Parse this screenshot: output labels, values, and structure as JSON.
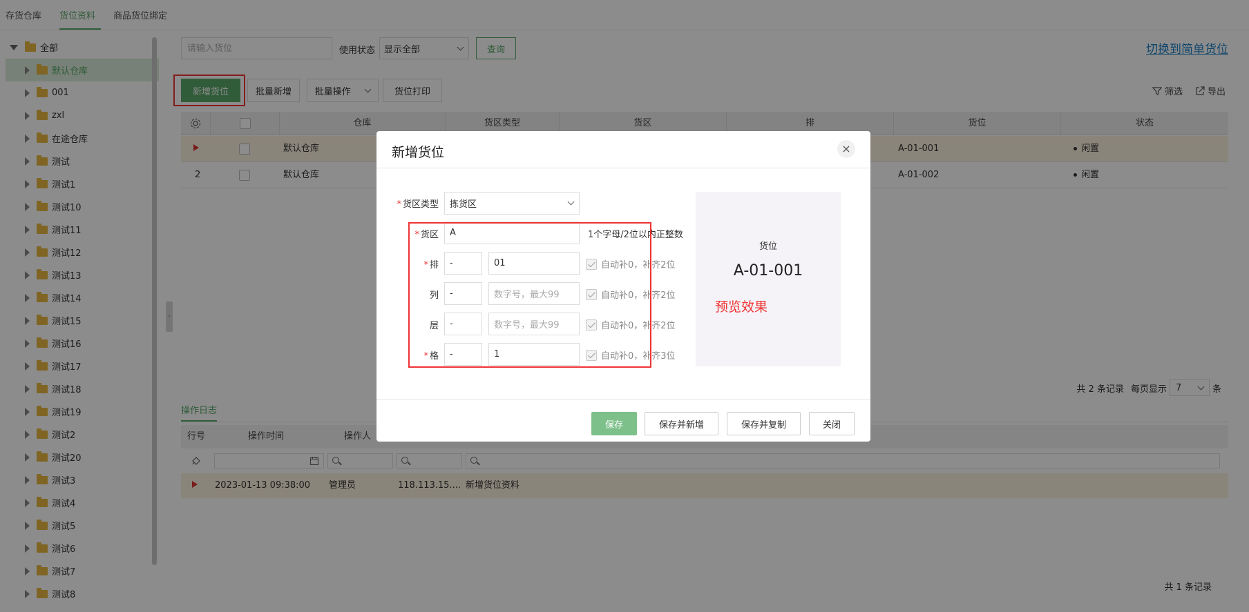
{
  "top_tabs": [
    {
      "label": "存货仓库"
    },
    {
      "label": "货位资料"
    },
    {
      "label": "商品货位绑定"
    }
  ],
  "tree": {
    "root_label": "全部",
    "items": [
      "默认仓库",
      "001",
      "zxl",
      "在途仓库",
      "测试",
      "测试1",
      "测试10",
      "测试11",
      "测试12",
      "测试13",
      "测试14",
      "测试15",
      "测试16",
      "测试17",
      "测试18",
      "测试19",
      "测试2",
      "测试20",
      "测试3",
      "测试4",
      "测试5",
      "测试6",
      "测试7",
      "测试8"
    ]
  },
  "toolbar": {
    "search_placeholder": "请输入货位",
    "status_label": "使用状态",
    "status_value": "显示全部",
    "query_label": "查询",
    "switch_link": "切换到简单货位",
    "add_label": "新增货位",
    "batch_add_label": "批量新增",
    "batch_ops_label": "批量操作",
    "print_label": "货位打印",
    "filter_label": "筛选",
    "export_label": "导出"
  },
  "grid": {
    "columns": [
      "仓库",
      "货区类型",
      "货区",
      "排",
      "货位",
      "状态"
    ],
    "rows": [
      {
        "index": "",
        "warehouse": "默认仓库",
        "location": "A-01-001",
        "status": "闲置"
      },
      {
        "index": "2",
        "warehouse": "默认仓库",
        "location": "A-01-002",
        "status": "闲置"
      }
    ],
    "pager": {
      "total_text": "共 2 条记录",
      "per_page_label": "每页显示",
      "per_page_value": "7",
      "unit": "条"
    }
  },
  "log": {
    "tab_label": "操作日志",
    "columns": [
      "行号",
      "操作时间",
      "操作人"
    ],
    "rows": [
      {
        "time": "2023-01-13 09:38:00",
        "operator": "管理员",
        "ip": "118.113.15....",
        "action": "新增货位资料"
      }
    ],
    "total_text": "共 1 条记录"
  },
  "modal": {
    "title": "新增货位",
    "close_icon": "×",
    "zone_type_label": "货区类型",
    "zone_type_value": "拣货区",
    "zone_label": "货区",
    "zone_value": "A",
    "zone_hint": "1个字母/2位以内正整数",
    "row_label": "排",
    "row_sep": "-",
    "row_value": "01",
    "row_check": "自动补0，补齐2位",
    "col_label": "列",
    "col_sep": "-",
    "col_placeholder": "数字号，最大99",
    "col_check": "自动补0，补齐2位",
    "layer_label": "层",
    "layer_sep": "-",
    "layer_placeholder": "数字号，最大99",
    "layer_check": "自动补0，补齐2位",
    "cell_label": "格",
    "cell_sep": "-",
    "cell_value": "1",
    "cell_check": "自动补0，补齐3位",
    "preview_label": "货位",
    "preview_code": "A-01-001",
    "preview_note": "预览效果",
    "btn_save": "保存",
    "btn_save_new": "保存并新增",
    "btn_save_copy": "保存并复制",
    "btn_close": "关闭"
  },
  "colors": {
    "brand_green": "#5aa86a",
    "annotation_red": "#e33333",
    "link_blue": "#1a7ec3"
  }
}
